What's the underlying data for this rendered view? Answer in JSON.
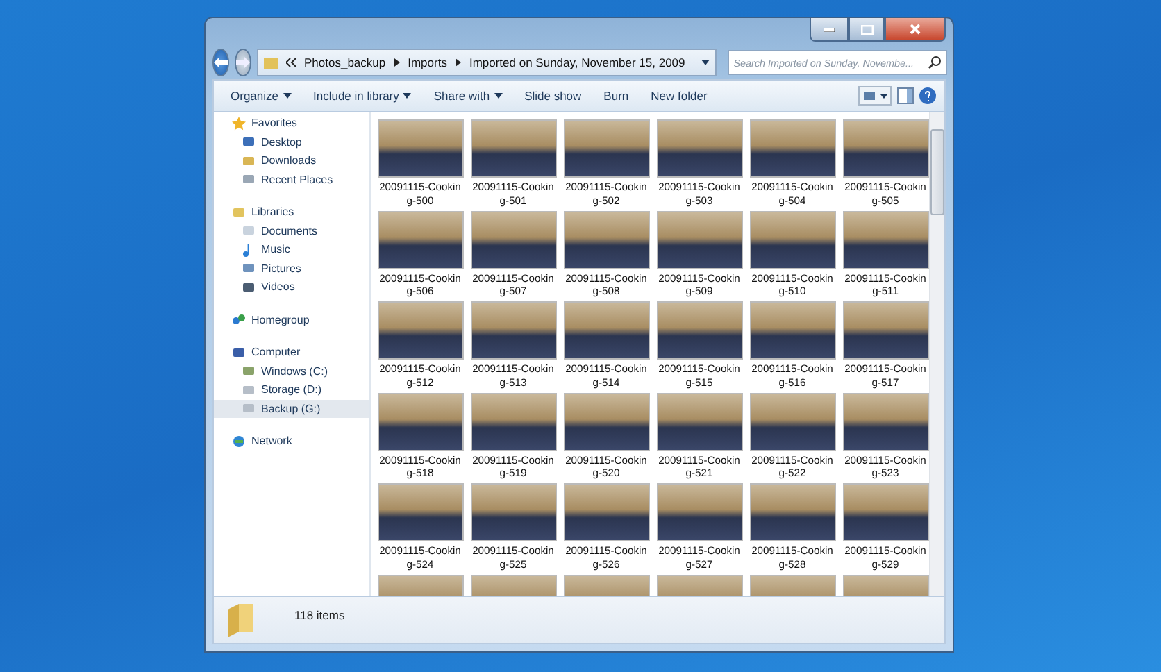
{
  "address": {
    "crumbs": [
      "Photos_backup",
      "Imports",
      "Imported on Sunday, November 15, 2009"
    ]
  },
  "search": {
    "placeholder": "Search Imported on Sunday, Novembe..."
  },
  "toolbar": [
    {
      "label": "Organize",
      "dropdown": true
    },
    {
      "label": "Include in library",
      "dropdown": true
    },
    {
      "label": "Share with",
      "dropdown": true
    },
    {
      "label": "Slide show",
      "dropdown": false
    },
    {
      "label": "Burn",
      "dropdown": false
    },
    {
      "label": "New folder",
      "dropdown": false
    }
  ],
  "sidebar": {
    "groups": [
      {
        "label": "Favorites",
        "children": [
          {
            "label": "Desktop",
            "selected": false
          },
          {
            "label": "Downloads",
            "selected": false
          },
          {
            "label": "Recent Places",
            "selected": false
          }
        ]
      },
      {
        "label": "Libraries",
        "children": [
          {
            "label": "Documents",
            "selected": false
          },
          {
            "label": "Music",
            "selected": false
          },
          {
            "label": "Pictures",
            "selected": false
          },
          {
            "label": "Videos",
            "selected": false
          }
        ]
      },
      {
        "label": "Homegroup"
      },
      {
        "label": "Computer",
        "children": [
          {
            "label": "Windows (C:)",
            "selected": false
          },
          {
            "label": "Storage (D:)",
            "selected": false
          },
          {
            "label": "Backup (G:)",
            "selected": true
          }
        ]
      },
      {
        "label": "Network"
      }
    ]
  },
  "files": [
    {
      "kind": "labeled",
      "label": "20091115-Cooking-500"
    },
    {
      "kind": "labeled",
      "label": "20091115-Cooking-501"
    },
    {
      "kind": "labeled",
      "label": "20091115-Cooking-502"
    },
    {
      "kind": "labeled",
      "label": "20091115-Cooking-503"
    },
    {
      "kind": "labeled",
      "label": "20091115-Cooking-504"
    },
    {
      "kind": "labeled",
      "label": "20091115-Cooking-505"
    },
    {
      "kind": "labeled",
      "label": "20091115-Cooking-506"
    },
    {
      "kind": "labeled",
      "label": "20091115-Cooking-507"
    },
    {
      "kind": "labeled",
      "label": "20091115-Cooking-508"
    },
    {
      "kind": "labeled",
      "label": "20091115-Cooking-509"
    },
    {
      "kind": "labeled",
      "label": "20091115-Cooking-510"
    },
    {
      "kind": "labeled",
      "label": "20091115-Cooking-511"
    },
    {
      "kind": "labeled",
      "label": "20091115-Cooking-512"
    },
    {
      "kind": "labeled",
      "label": "20091115-Cooking-513"
    },
    {
      "kind": "labeled",
      "label": "20091115-Cooking-514"
    },
    {
      "kind": "labeled",
      "label": "20091115-Cooking-515"
    },
    {
      "kind": "labeled",
      "label": "20091115-Cooking-516"
    },
    {
      "kind": "labeled",
      "label": "20091115-Cooking-517"
    },
    {
      "kind": "labeled",
      "label": "20091115-Cooking-518"
    },
    {
      "kind": "labeled",
      "label": "20091115-Cooking-519"
    },
    {
      "kind": "labeled",
      "label": "20091115-Cooking-520"
    },
    {
      "kind": "labeled",
      "label": "20091115-Cooking-521"
    },
    {
      "kind": "labeled",
      "label": "20091115-Cooking-522"
    },
    {
      "kind": "labeled",
      "label": "20091115-Cooking-523"
    },
    {
      "kind": "labeled",
      "label": "20091115-Cooking-524"
    },
    {
      "kind": "labeled",
      "label": "20091115-Cooking-525"
    },
    {
      "kind": "labeled",
      "label": "20091115-Cooking-526"
    },
    {
      "kind": "labeled",
      "label": "20091115-Cooking-527"
    },
    {
      "kind": "labeled",
      "label": "20091115-Cooking-528"
    },
    {
      "kind": "labeled",
      "label": "20091115-Cooking-529"
    },
    {
      "kind": "partial"
    },
    {
      "kind": "partial"
    },
    {
      "kind": "partial"
    },
    {
      "kind": "partial"
    },
    {
      "kind": "partial"
    },
    {
      "kind": "partial"
    }
  ],
  "status_bar": {
    "count": "118 items"
  }
}
